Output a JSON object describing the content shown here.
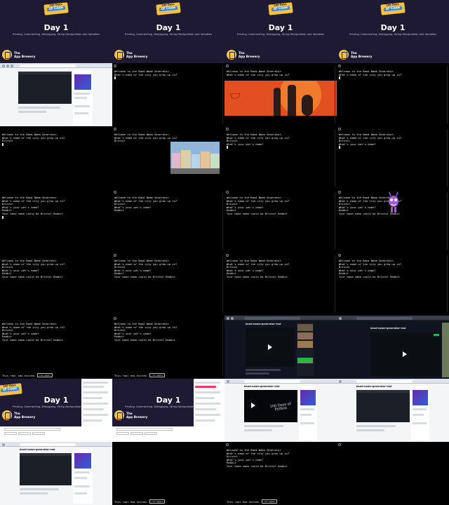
{
  "title_frame": {
    "badge_top": "100 Days",
    "badge_bottom": "of Code",
    "day": "Day 1",
    "subtitle": "Printing, Commenting, Debugging, String Manipulation and Variables",
    "brand_top": "The",
    "brand_bottom": "App Brewery"
  },
  "console": {
    "welcome": "Welcome to the Band Name Generator.",
    "q_city": "What's name of the city you grew up in?",
    "city_answer": "Bristol",
    "q_pet": "What's your pet's name?",
    "pet_answer": "Rabbit",
    "result": "Your band name could be Bristol Rabbit",
    "exited": "This repl has exited.",
    "run_again": "run again"
  },
  "browser": {
    "repl_title": "band-name-generator-end",
    "video_caption": "100 Days of Python"
  },
  "colors": {
    "title_bg": "#1f1a33",
    "badge": "#f6c143",
    "badge_blue": "#2b8be6",
    "console_bg": "#000000",
    "console_text": "#e6e6e6",
    "orange_art": "#e24f21",
    "repl_green": "#2bb24c"
  }
}
